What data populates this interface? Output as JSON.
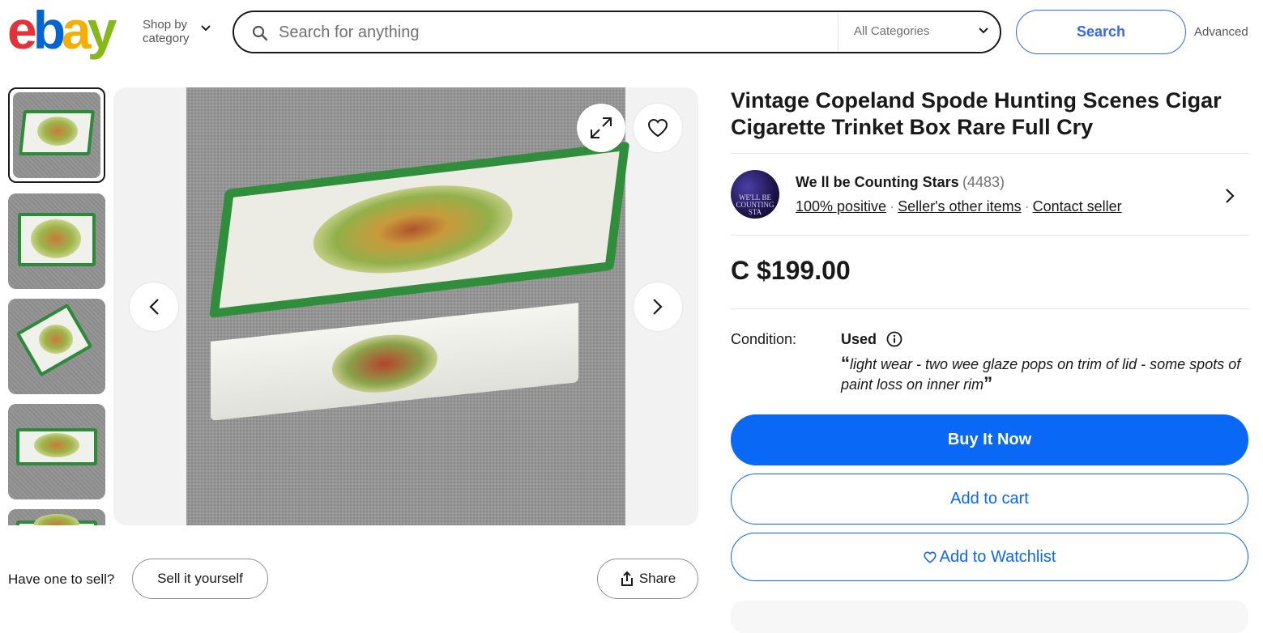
{
  "header": {
    "logo_letters": [
      "e",
      "b",
      "a",
      "y"
    ],
    "shop_by_line1": "Shop by",
    "shop_by_line2": "category",
    "search_placeholder": "Search for anything",
    "category_select": "All Categories",
    "search_button": "Search",
    "advanced_link": "Advanced"
  },
  "gallery": {
    "thumbnail_count_visible": 5,
    "active_index": 0
  },
  "sell": {
    "prompt": "Have one to sell?",
    "sell_button": "Sell it yourself",
    "share_button": "Share"
  },
  "listing": {
    "title": "Vintage Copeland Spode Hunting Scenes Cigar Cigarette Trinket Box Rare Full Cry",
    "seller": {
      "name": "We ll be Counting Stars",
      "feedback_count": "(4483)",
      "positive": "100% positive",
      "other_items": "Seller's other items",
      "contact": "Contact seller",
      "avatar_text": "WE'LL BE COUNTING STA"
    },
    "price": "C $199.00",
    "condition_label": "Condition:",
    "condition_value": "Used",
    "condition_desc": "light wear - two wee glaze pops on trim of lid - some spots of paint loss on inner rim",
    "buy_now": "Buy It Now",
    "add_to_cart": "Add to cart",
    "add_to_watchlist": "Add to Watchlist"
  },
  "colors": {
    "ebay_red": "#e53238",
    "ebay_blue": "#0064d2",
    "ebay_yellow": "#f5af02",
    "ebay_green": "#86b817",
    "primary_blue": "#0968f6",
    "search_blue": "#3665f3",
    "trim_green": "#2f8d3c"
  },
  "icons": [
    "search-icon",
    "chevron-down-icon",
    "expand-icon",
    "heart-icon",
    "chevron-left-icon",
    "chevron-right-icon",
    "share-icon",
    "info-icon"
  ]
}
